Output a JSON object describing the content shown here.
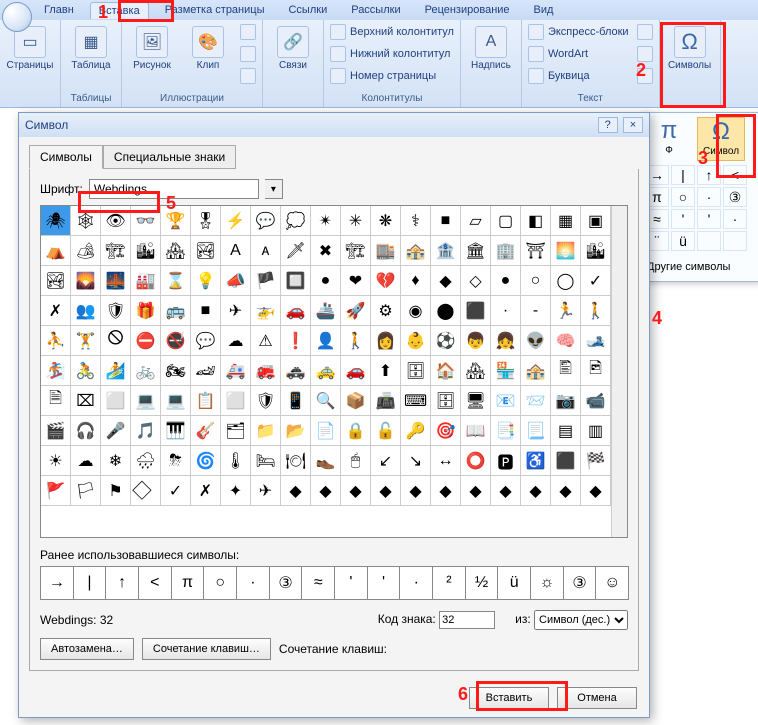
{
  "ribbon_tabs": [
    "Главн",
    "Вставка",
    "Разметка страницы",
    "Ссылки",
    "Рассылки",
    "Рецензирование",
    "Вид"
  ],
  "ribbon_active": 1,
  "groups": {
    "pages": {
      "btn": "Страницы",
      "label": ""
    },
    "tables": {
      "btn": "Таблица",
      "label": "Таблицы"
    },
    "illus": {
      "btns": [
        "Рисунок",
        "Клип"
      ],
      "label": "Иллюстрации"
    },
    "links": {
      "btn": "Связи",
      "label": ""
    },
    "hdrftr": {
      "items": [
        "Верхний колонтитул",
        "Нижний колонтитул",
        "Номер страницы"
      ],
      "label": "Колонтитулы"
    },
    "textbox": {
      "btn": "Надпись"
    },
    "text": {
      "items": [
        "Экспресс-блоки",
        "WordArt",
        "Буквица"
      ],
      "label": "Текст"
    },
    "symbols": {
      "btn": "Символы",
      "label": ""
    }
  },
  "dropdown": {
    "formula": "Ф",
    "symbol": "Символ",
    "mini": [
      "→",
      "|",
      "↑",
      "<",
      "π",
      "○",
      "·",
      "③",
      "≈",
      "'",
      "'",
      "·",
      "¨",
      "ü",
      "",
      ""
    ],
    "more": "Другие символы"
  },
  "dialog": {
    "title": "Символ",
    "help": "?",
    "close": "×",
    "tabs": [
      "Символы",
      "Специальные знаки"
    ],
    "font_label": "Шрифт:",
    "font_value": "Webdings",
    "recent_label": "Ранее использовавшиеся символы:",
    "recent": [
      "→",
      "|",
      "↑",
      "<",
      "π",
      "○",
      "·",
      "③",
      "≈",
      "'",
      "'",
      "·",
      "²",
      "½",
      "ü",
      "☼",
      "③",
      "☺"
    ],
    "name_label": "Webdings: 32",
    "code_label": "Код знака:",
    "code_value": "32",
    "from_label": "из:",
    "from_value": "Символ (дес.)",
    "auto_btn": "Автозамена…",
    "shortcut_btn": "Сочетание клавиш…",
    "shortcut_label": "Сочетание клавиш:",
    "insert_btn": "Вставить",
    "cancel_btn": "Отмена"
  },
  "callouts": {
    "1": "1",
    "2": "2",
    "3": "3",
    "4": "4",
    "5": "5",
    "6": "6"
  }
}
